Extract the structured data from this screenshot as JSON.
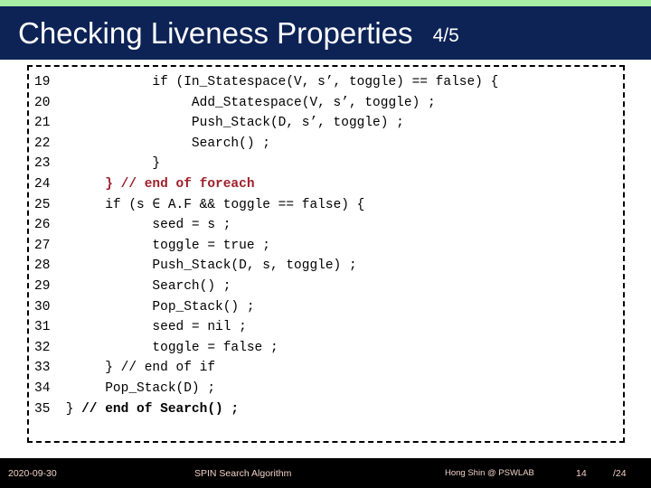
{
  "theme": {
    "accent_strip_color": "#a8efa6",
    "title_bar_color": "#0d2356",
    "title_text_color": "#ffffff",
    "body_background": "#ffffff",
    "code_text_color": "#000000",
    "comment_color": "#9e1f2b",
    "footer_bar_color": "#000000",
    "footer_text_color": "#f0cfc4"
  },
  "header": {
    "title": "Checking Liveness Properties",
    "counter": "4/5"
  },
  "code": {
    "lines": [
      {
        "number": "19",
        "text": "            if (In_Statespace(V, s’, toggle) == false) {",
        "style": "plain"
      },
      {
        "number": "20",
        "text": "                 Add_Statespace(V, s’, toggle) ;",
        "style": "plain"
      },
      {
        "number": "21",
        "text": "                 Push_Stack(D, s’, toggle) ;",
        "style": "plain"
      },
      {
        "number": "22",
        "text": "                 Search() ;",
        "style": "plain"
      },
      {
        "number": "23",
        "text": "            }",
        "style": "plain"
      },
      {
        "number": "24",
        "text": "      } // end of foreach",
        "style": "comment-red"
      },
      {
        "number": "25",
        "text": "      if (s ∈ A.F && toggle == false) {",
        "style": "plain"
      },
      {
        "number": "26",
        "text": "            seed = s ;",
        "style": "plain"
      },
      {
        "number": "27",
        "text": "            toggle = true ;",
        "style": "plain"
      },
      {
        "number": "28",
        "text": "            Push_Stack(D, s, toggle) ;",
        "style": "plain"
      },
      {
        "number": "29",
        "text": "            Search() ;",
        "style": "plain"
      },
      {
        "number": "30",
        "text": "            Pop_Stack() ;",
        "style": "plain"
      },
      {
        "number": "31",
        "text": "            seed = nil ;",
        "style": "plain"
      },
      {
        "number": "32",
        "text": "            toggle = false ;",
        "style": "plain"
      },
      {
        "number": "33",
        "text": "      } // end of if",
        "style": "plain"
      },
      {
        "number": "34",
        "text": "      Pop_Stack(D) ;",
        "style": "plain"
      },
      {
        "number": "35",
        "text": " } // end of Search() ;",
        "style": "bold-tail"
      }
    ]
  },
  "footer": {
    "date": "2020-09-30",
    "subject": "SPIN Search Algorithm",
    "author": "Hong Shin @ PSWLAB",
    "page_number": "14",
    "page_total": "/24"
  }
}
